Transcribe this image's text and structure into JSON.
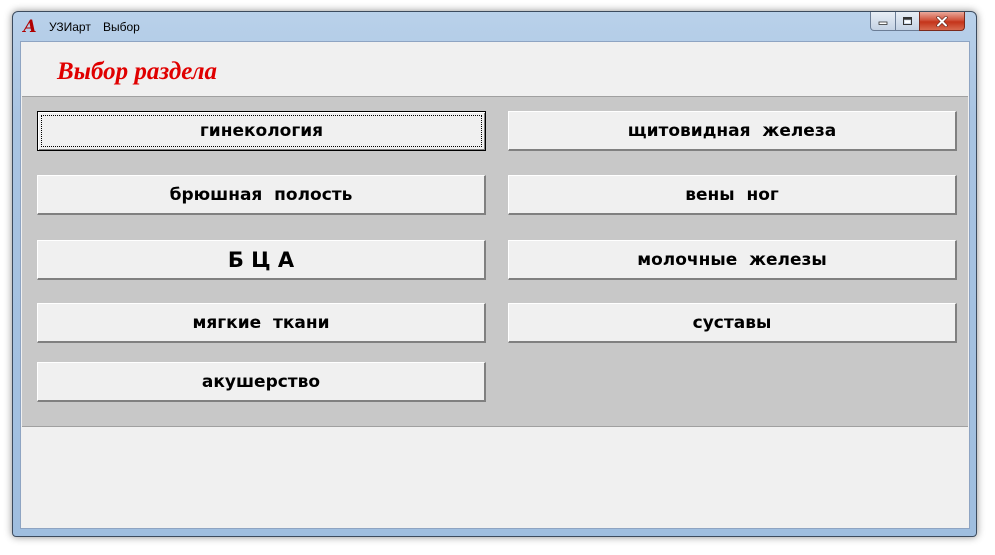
{
  "window": {
    "menu": [
      "УЗИарт",
      "Выбор"
    ],
    "icons": {
      "app": "app-logo-icon",
      "minimize": "minimize-icon",
      "maximize": "maximize-icon",
      "close": "close-icon"
    },
    "app_icon_glyph": "A"
  },
  "header": {
    "title": "Выбор раздела",
    "title_color": "#e00000"
  },
  "sections": [
    {
      "label": "гинекология",
      "focused": true
    },
    {
      "label": "щитовидная  железа"
    },
    {
      "label": "брюшная  полость"
    },
    {
      "label": "вены  ног"
    },
    {
      "label": "Б Ц А"
    },
    {
      "label": "молочные  железы"
    },
    {
      "label": "мягкие  ткани"
    },
    {
      "label": "суставы"
    },
    {
      "label": "акушерство"
    }
  ]
}
